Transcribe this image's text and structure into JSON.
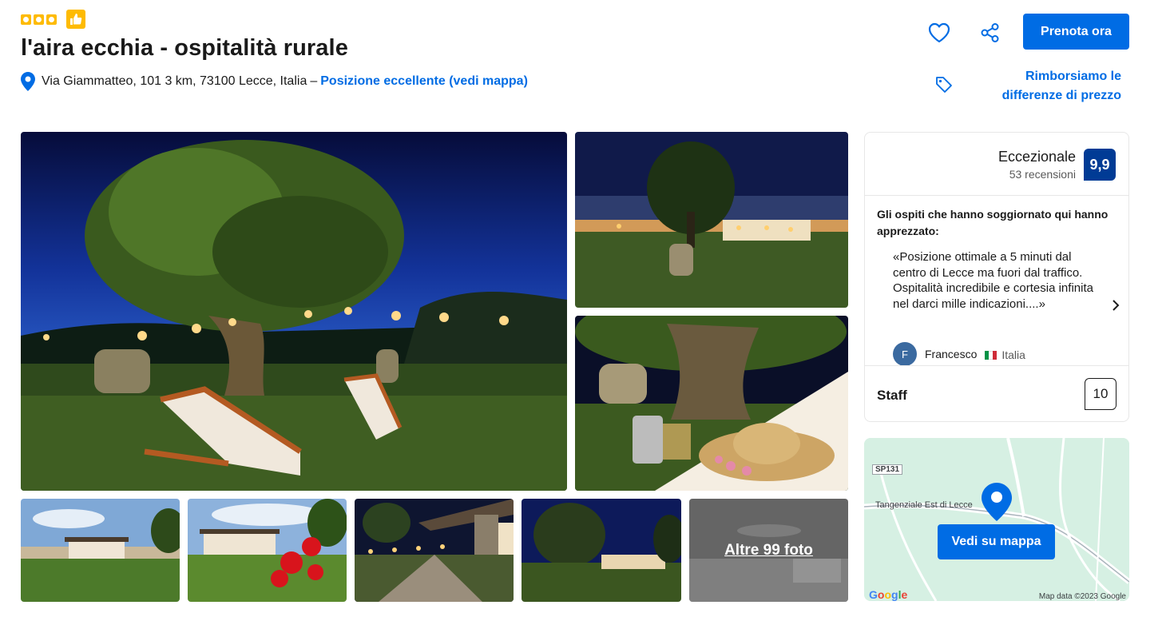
{
  "header": {
    "title": "l'aira ecchia - ospitalità rurale",
    "address": "Via Giammatteo, 101 3 km, 73100 Lecce, Italia",
    "address_separator": "–",
    "location_link": "Posizione eccellente (vedi mappa)",
    "book_button": "Prenota ora",
    "refund_text": "Rimborsiamo le differenze di prezzo"
  },
  "gallery": {
    "more_photos": "Altre 99 foto"
  },
  "reviews": {
    "rating_label": "Eccezionale",
    "review_count": "53 recensioni",
    "score": "9,9",
    "liked_heading": "Gli ospiti che hanno soggiornato qui hanno apprezzato:",
    "quote": "«Posizione ottimale a 5 minuti dal centro di Lecce ma fuori dal traffico. Ospitalità incredibile e cortesia infinita nel darci mille indicazioni....»",
    "reviewer_initial": "F",
    "reviewer_name": "Francesco",
    "reviewer_country": "Italia",
    "category_label": "Staff",
    "category_score": "10"
  },
  "map": {
    "road_sp": "SP131",
    "road_tangenziale": "Tangenziale Est di Lecce",
    "button": "Vedi su mappa",
    "credit": "Map data ©2023 Google",
    "google": "Google"
  },
  "colors": {
    "primary_blue": "#006ce4",
    "score_blue": "#003b95",
    "star_yellow": "#febb02"
  },
  "icons": [
    "star-icon",
    "thumbs-up-icon",
    "map-pin-icon",
    "heart-icon",
    "share-icon",
    "price-tag-icon",
    "chevron-right-icon",
    "italy-flag-icon",
    "map-marker-icon"
  ]
}
